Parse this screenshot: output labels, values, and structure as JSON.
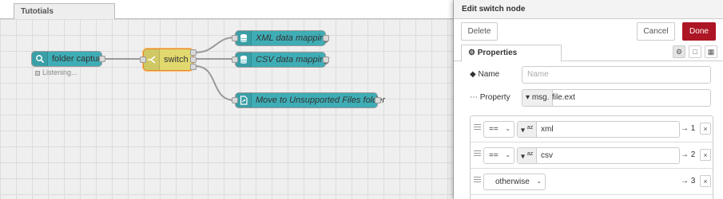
{
  "workspace": {
    "flow_tab": "Tutotials",
    "nodes": {
      "folder_capture": {
        "label": "folder capture",
        "status": "Listening...",
        "icon": "search-icon"
      },
      "switch": {
        "label": "switch",
        "icon": "switch-icon"
      },
      "xml_mapping": {
        "label": "XML data mapping",
        "icon": "database-icon"
      },
      "csv_mapping": {
        "label": "CSV data mapping",
        "icon": "database-icon"
      },
      "move_unsupported": {
        "label": "Move to Unsupported Files folder",
        "icon": "file-icon"
      }
    },
    "colors": {
      "teal_node": "#3fadb5",
      "switch_node": "#e2d96e",
      "selected_outline": "#ff7f0e"
    }
  },
  "panel": {
    "title": "Edit switch node",
    "toolbar": {
      "delete": "Delete",
      "cancel": "Cancel",
      "done": "Done"
    },
    "tabs": {
      "properties": "Properties",
      "properties_icon": "gear-icon"
    },
    "form": {
      "name_label": "Name",
      "name_placeholder": "Name",
      "property_label": "Property",
      "property_type": "msg.",
      "property_value": "file.ext"
    },
    "rules": [
      {
        "operator": "==",
        "type_icon": "az",
        "value": "xml",
        "output": "→ 1"
      },
      {
        "operator": "==",
        "type_icon": "az",
        "value": "csv",
        "output": "→ 2"
      },
      {
        "operator": "otherwise",
        "output": "→ 3"
      }
    ],
    "colors": {
      "done_button": "#ad1625"
    }
  }
}
